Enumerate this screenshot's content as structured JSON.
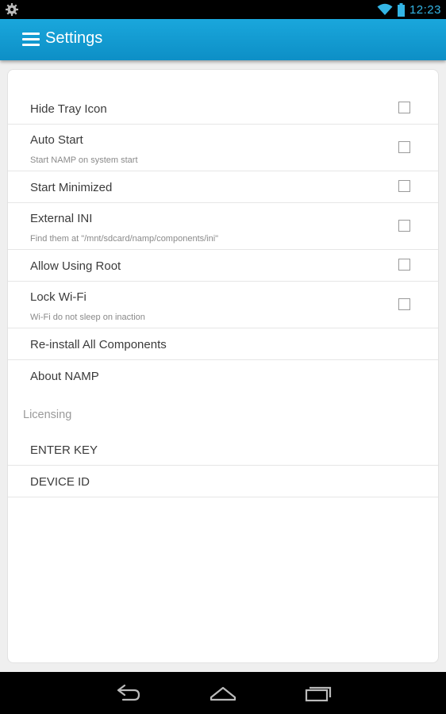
{
  "status_bar": {
    "time": "12:23",
    "left_icon": "gear-notification-icon",
    "wifi_icon": "wifi-icon",
    "battery_icon": "battery-icon"
  },
  "action_bar": {
    "menu_icon": "hamburger-menu-icon",
    "title": "Settings",
    "color": "#1aa7dc"
  },
  "settings": {
    "items": [
      {
        "title": "Hide Tray Icon",
        "subtitle": "",
        "has_checkbox": true,
        "checked": false
      },
      {
        "title": "Auto Start",
        "subtitle": "Start NAMP on system start",
        "has_checkbox": true,
        "checked": false
      },
      {
        "title": "Start Minimized",
        "subtitle": "",
        "has_checkbox": true,
        "checked": false
      },
      {
        "title": "External INI",
        "subtitle": "Find them at \"/mnt/sdcard/namp/components/ini\"",
        "has_checkbox": true,
        "checked": false
      },
      {
        "title": "Allow Using Root",
        "subtitle": "",
        "has_checkbox": true,
        "checked": false
      },
      {
        "title": "Lock Wi-Fi",
        "subtitle": "Wi-Fi do not sleep on inaction",
        "has_checkbox": true,
        "checked": false
      },
      {
        "title": "Re-install All Components",
        "subtitle": "",
        "has_checkbox": false
      },
      {
        "title": "About NAMP",
        "subtitle": "",
        "has_checkbox": false
      }
    ]
  },
  "licensing": {
    "header": "Licensing",
    "items": [
      {
        "title": "ENTER KEY"
      },
      {
        "title": "DEVICE ID"
      }
    ]
  },
  "nav_bar": {
    "back_icon": "back-icon",
    "home_icon": "home-icon",
    "recents_icon": "recent-apps-icon"
  }
}
